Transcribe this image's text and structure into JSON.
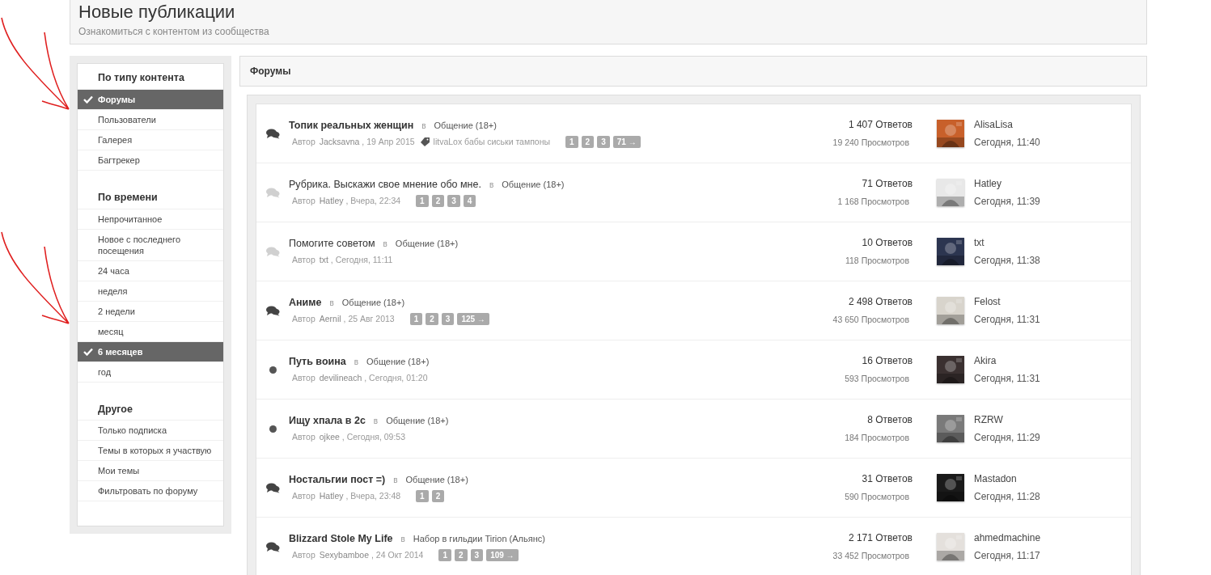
{
  "header": {
    "title": "Новые публикации",
    "subtitle": "Ознакомиться с контентом из сообщества"
  },
  "sidebar": {
    "sections": [
      {
        "title": "По типу контента",
        "items": [
          {
            "label": "Форумы",
            "selected": true
          },
          {
            "label": "Пользователи",
            "selected": false
          },
          {
            "label": "Галерея",
            "selected": false
          },
          {
            "label": "Багтрекер",
            "selected": false
          }
        ]
      },
      {
        "title": "По времени",
        "items": [
          {
            "label": "Непрочитанное",
            "selected": false
          },
          {
            "label": "Новое с последнего посещения",
            "selected": false
          },
          {
            "label": "24 часа",
            "selected": false
          },
          {
            "label": "неделя",
            "selected": false
          },
          {
            "label": "2 недели",
            "selected": false
          },
          {
            "label": "месяц",
            "selected": false
          },
          {
            "label": "6 месяцев",
            "selected": true
          },
          {
            "label": "год",
            "selected": false
          }
        ]
      },
      {
        "title": "Другое",
        "items": [
          {
            "label": "Только подписка",
            "selected": false
          },
          {
            "label": "Темы в которых я участвую",
            "selected": false
          },
          {
            "label": "Мои темы",
            "selected": false
          },
          {
            "label": "Фильтровать по форуму",
            "selected": false
          }
        ]
      }
    ]
  },
  "main": {
    "title": "Форумы",
    "topics": [
      {
        "kind": "bubbles",
        "unread": true,
        "title": "Топик реальных женщин",
        "in": "в",
        "forum": "Общение (18+)",
        "author_label": "Автор",
        "author": "Jacksavna",
        "date": ", 19 Апр 2015",
        "tags": "litvaLox бабы сиськи тампоны",
        "pages": [
          "1",
          "2",
          "3",
          "71 →"
        ],
        "replies": "1 407 Ответов",
        "views": "19 240 Просмотров",
        "last_user": "AlisaLisa",
        "last_time": "Сегодня, 11:40"
      },
      {
        "kind": "bubbles",
        "unread": false,
        "title": "Рубрика. Выскажи свое мнение обо мне.",
        "in": "в",
        "forum": "Общение (18+)",
        "author_label": "Автор",
        "author": "Hatley",
        "date": ", Вчера, 22:34",
        "pages": [
          "1",
          "2",
          "3",
          "4"
        ],
        "replies": "71 Ответов",
        "views": "1 168 Просмотров",
        "last_user": "Hatley",
        "last_time": "Сегодня, 11:39"
      },
      {
        "kind": "bubbles",
        "unread": false,
        "title": "Помогите советом",
        "in": "в",
        "forum": "Общение (18+)",
        "author_label": "Автор",
        "author": "txt",
        "date": ", Сегодня, 11:11",
        "replies": "10 Ответов",
        "views": "118 Просмотров",
        "last_user": "txt",
        "last_time": "Сегодня, 11:38"
      },
      {
        "kind": "bubbles",
        "unread": true,
        "title": "Аниме",
        "in": "в",
        "forum": "Общение (18+)",
        "author_label": "Автор",
        "author": "Aernil",
        "date": ", 25 Авг 2013",
        "pages": [
          "1",
          "2",
          "3",
          "125 →"
        ],
        "replies": "2 498 Ответов",
        "views": "43 650 Просмотров",
        "last_user": "Felost",
        "last_time": "Сегодня, 11:31"
      },
      {
        "kind": "dot",
        "unread": true,
        "title": "Путь воина",
        "in": "в",
        "forum": "Общение (18+)",
        "author_label": "Автор",
        "author": "devilineach",
        "date": ", Сегодня, 01:20",
        "replies": "16 Ответов",
        "views": "593 Просмотров",
        "last_user": "Akira",
        "last_time": "Сегодня, 11:31"
      },
      {
        "kind": "dot",
        "unread": true,
        "title": "Ищу хпала в 2с",
        "in": "в",
        "forum": "Общение (18+)",
        "author_label": "Автор",
        "author": "ojkee",
        "date": ", Сегодня, 09:53",
        "replies": "8 Ответов",
        "views": "184 Просмотров",
        "last_user": "RZRW",
        "last_time": "Сегодня, 11:29"
      },
      {
        "kind": "bubbles",
        "unread": true,
        "title": "Ностальгии пост =)",
        "in": "в",
        "forum": "Общение (18+)",
        "author_label": "Автор",
        "author": "Hatley",
        "date": ", Вчера, 23:48",
        "pages": [
          "1",
          "2"
        ],
        "replies": "31 Ответов",
        "views": "590 Просмотров",
        "last_user": "Mastadon",
        "last_time": "Сегодня, 11:28"
      },
      {
        "kind": "bubbles",
        "unread": true,
        "title": "Blizzard Stole My Life",
        "in": "в",
        "forum": "Набор в гильдии Tirion (Альянс)",
        "author_label": "Автор",
        "author": "Sexybamboe",
        "date": ", 24 Окт 2014",
        "pages": [
          "1",
          "2",
          "3",
          "109 →"
        ],
        "replies": "2 171 Ответов",
        "views": "33 452 Просмотров",
        "last_user": "ahmedmachine",
        "last_time": "Сегодня, 11:17"
      }
    ]
  }
}
